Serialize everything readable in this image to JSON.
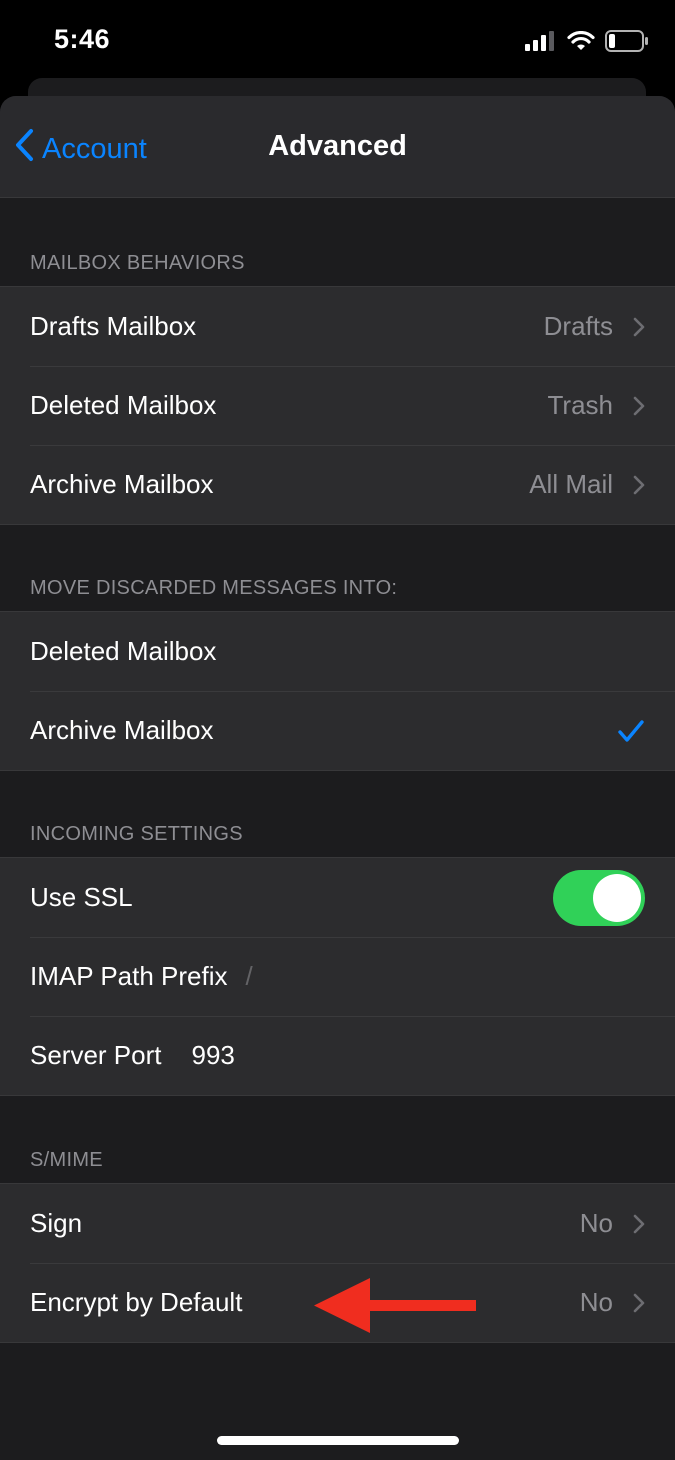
{
  "status": {
    "time": "5:46"
  },
  "nav": {
    "back_label": "Account",
    "title": "Advanced"
  },
  "sections": {
    "mailbox_behaviors": {
      "header": "MAILBOX BEHAVIORS",
      "rows": [
        {
          "label": "Drafts Mailbox",
          "value": "Drafts"
        },
        {
          "label": "Deleted Mailbox",
          "value": "Trash"
        },
        {
          "label": "Archive Mailbox",
          "value": "All Mail"
        }
      ]
    },
    "move_discarded": {
      "header": "MOVE DISCARDED MESSAGES INTO:",
      "rows": [
        {
          "label": "Deleted Mailbox",
          "selected": false
        },
        {
          "label": "Archive Mailbox",
          "selected": true
        }
      ]
    },
    "incoming": {
      "header": "INCOMING SETTINGS",
      "use_ssl": {
        "label": "Use SSL",
        "on": true
      },
      "imap_prefix": {
        "label": "IMAP Path Prefix",
        "value": "/"
      },
      "server_port": {
        "label": "Server Port",
        "value": "993"
      }
    },
    "smime": {
      "header": "S/MIME",
      "rows": [
        {
          "label": "Sign",
          "value": "No"
        },
        {
          "label": "Encrypt by Default",
          "value": "No"
        }
      ]
    }
  },
  "colors": {
    "accent": "#0a84ff",
    "toggle_on": "#30d158",
    "annotation_arrow": "#f02d1f"
  }
}
